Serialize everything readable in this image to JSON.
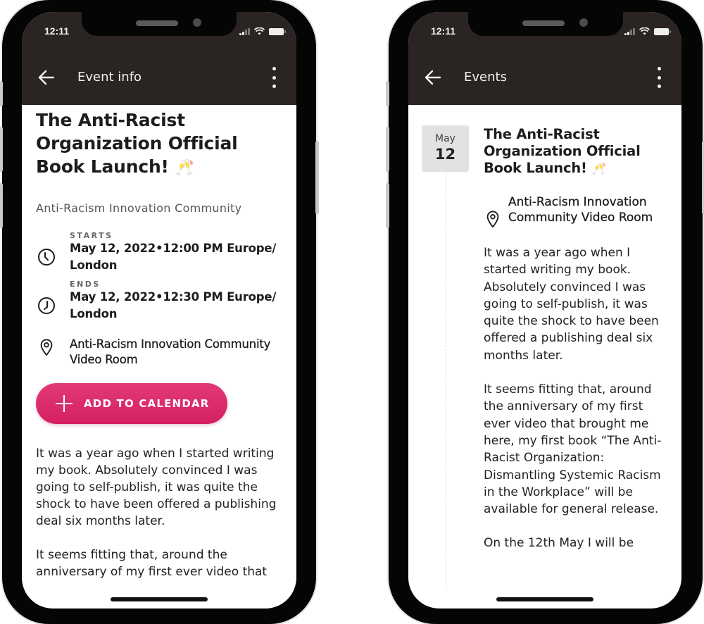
{
  "left_phone": {
    "status_bar": {
      "time": "12:11"
    },
    "nav": {
      "title": "Event info",
      "back_icon": "arrow-left-icon",
      "more_icon": "more-vertical-icon"
    },
    "event": {
      "title": "The Anti-Racist Organization Official Book Launch!",
      "title_emoji": "🥂",
      "community": "Anti-Racism Innovation Community",
      "starts_label": "STARTS",
      "starts_value": "May 12, 2022•12:00 PM Europe/ London",
      "ends_label": "ENDS",
      "ends_value": "May 12, 2022•12:30 PM Europe/ London",
      "location": "Anti-Racism Innovation Community Video Room",
      "add_to_calendar_label": "ADD TO CALENDAR",
      "description": [
        "It was a year ago when I started writing my book. Absolutely convinced I was going to self-publish, it was quite the shock to have been offered a publishing deal six months later.",
        "It seems fitting that, around the anniversary of my first ever video that"
      ]
    },
    "colors": {
      "accent": "#d82566",
      "header_bg": "#2a2522"
    }
  },
  "right_phone": {
    "status_bar": {
      "time": "12:11"
    },
    "nav": {
      "title": "Events",
      "back_icon": "arrow-left-icon",
      "more_icon": "more-vertical-icon"
    },
    "event": {
      "date_month": "May",
      "date_day": "12",
      "title": "The Anti-Racist Organization Official Book Launch!",
      "title_emoji": "🥂",
      "location": "Anti-Racism Innovation Community Video Room",
      "description": [
        "It was a year ago when I started writing my book. Absolutely convinced I was going to self-publish, it was quite the shock to have been offered a publishing deal six months later.",
        "It seems fitting that, around the anniversary of my first ever video that brought me here, my first book “The Anti-Racist Organization: Dismantling Systemic Racism in the Workplace” will be available for general release.",
        "On the 12th May I will be"
      ]
    }
  }
}
